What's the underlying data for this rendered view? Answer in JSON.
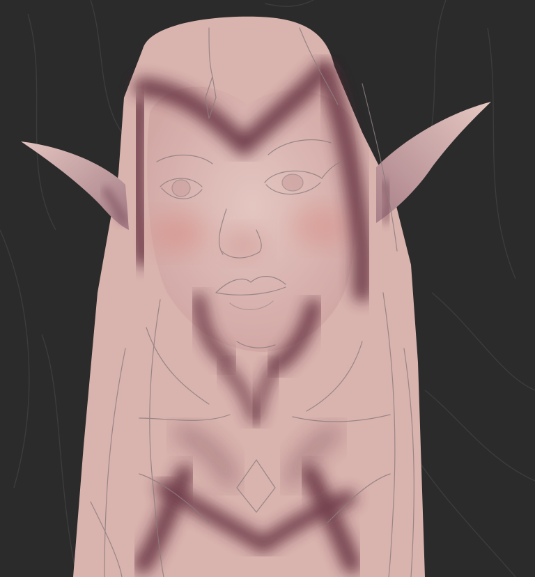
{
  "image": {
    "kind": "digital-painting-wip",
    "subject": "elf",
    "colors": {
      "background": "#2b2b2b",
      "skin_base": "#d9b3ae",
      "skin_light": "#e2c2bd",
      "shadow": "#5e2a3a",
      "blush": "#d9867e",
      "sketch_line": "#8d7e7e",
      "background_sketch": "#3d3d3d"
    }
  }
}
